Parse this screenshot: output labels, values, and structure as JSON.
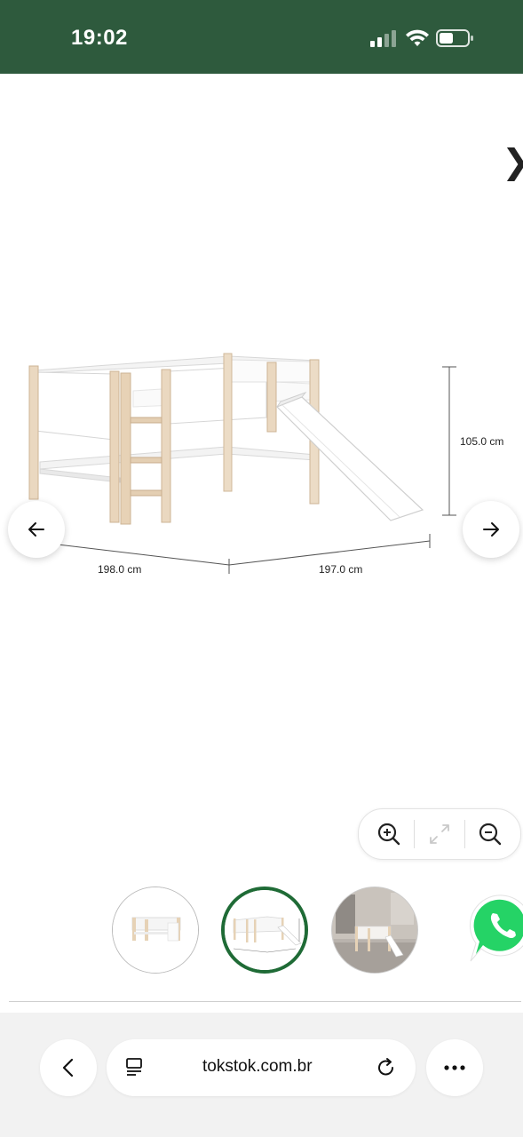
{
  "status_bar": {
    "time": "19:02"
  },
  "product_image": {
    "dimensions": {
      "width": "198.0 cm",
      "depth": "197.0 cm",
      "height": "105.0 cm"
    }
  },
  "viewer": {
    "prev_icon": "arrow-left-icon",
    "next_icon": "arrow-right-icon",
    "zoom_in_icon": "zoom-in-icon",
    "fullscreen_icon": "expand-icon",
    "zoom_out_icon": "zoom-out-icon",
    "close_glyph": "❯"
  },
  "thumbnails": {
    "selected_index": 1,
    "count": 3
  },
  "browser": {
    "url": "tokstok.com.br"
  },
  "colors": {
    "status_bar_bg": "#2e5a3d",
    "selected_thumb_border": "#1f6b36",
    "whatsapp": "#25d366"
  }
}
